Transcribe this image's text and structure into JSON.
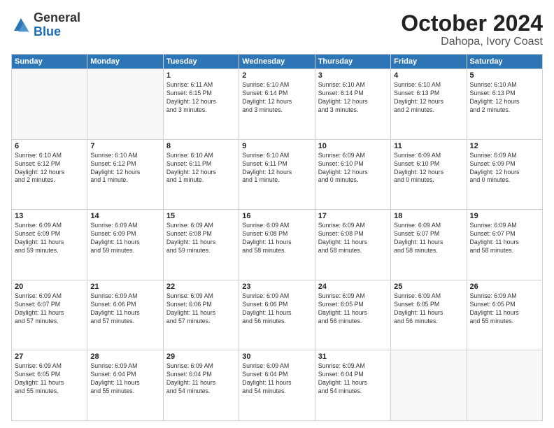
{
  "logo": {
    "line1": "General",
    "line2": "Blue"
  },
  "title": "October 2024",
  "subtitle": "Dahopa, Ivory Coast",
  "weekdays": [
    "Sunday",
    "Monday",
    "Tuesday",
    "Wednesday",
    "Thursday",
    "Friday",
    "Saturday"
  ],
  "weeks": [
    [
      {
        "day": "",
        "info": ""
      },
      {
        "day": "",
        "info": ""
      },
      {
        "day": "1",
        "info": "Sunrise: 6:11 AM\nSunset: 6:15 PM\nDaylight: 12 hours\nand 3 minutes."
      },
      {
        "day": "2",
        "info": "Sunrise: 6:10 AM\nSunset: 6:14 PM\nDaylight: 12 hours\nand 3 minutes."
      },
      {
        "day": "3",
        "info": "Sunrise: 6:10 AM\nSunset: 6:14 PM\nDaylight: 12 hours\nand 3 minutes."
      },
      {
        "day": "4",
        "info": "Sunrise: 6:10 AM\nSunset: 6:13 PM\nDaylight: 12 hours\nand 2 minutes."
      },
      {
        "day": "5",
        "info": "Sunrise: 6:10 AM\nSunset: 6:13 PM\nDaylight: 12 hours\nand 2 minutes."
      }
    ],
    [
      {
        "day": "6",
        "info": "Sunrise: 6:10 AM\nSunset: 6:12 PM\nDaylight: 12 hours\nand 2 minutes."
      },
      {
        "day": "7",
        "info": "Sunrise: 6:10 AM\nSunset: 6:12 PM\nDaylight: 12 hours\nand 1 minute."
      },
      {
        "day": "8",
        "info": "Sunrise: 6:10 AM\nSunset: 6:11 PM\nDaylight: 12 hours\nand 1 minute."
      },
      {
        "day": "9",
        "info": "Sunrise: 6:10 AM\nSunset: 6:11 PM\nDaylight: 12 hours\nand 1 minute."
      },
      {
        "day": "10",
        "info": "Sunrise: 6:09 AM\nSunset: 6:10 PM\nDaylight: 12 hours\nand 0 minutes."
      },
      {
        "day": "11",
        "info": "Sunrise: 6:09 AM\nSunset: 6:10 PM\nDaylight: 12 hours\nand 0 minutes."
      },
      {
        "day": "12",
        "info": "Sunrise: 6:09 AM\nSunset: 6:09 PM\nDaylight: 12 hours\nand 0 minutes."
      }
    ],
    [
      {
        "day": "13",
        "info": "Sunrise: 6:09 AM\nSunset: 6:09 PM\nDaylight: 11 hours\nand 59 minutes."
      },
      {
        "day": "14",
        "info": "Sunrise: 6:09 AM\nSunset: 6:09 PM\nDaylight: 11 hours\nand 59 minutes."
      },
      {
        "day": "15",
        "info": "Sunrise: 6:09 AM\nSunset: 6:08 PM\nDaylight: 11 hours\nand 59 minutes."
      },
      {
        "day": "16",
        "info": "Sunrise: 6:09 AM\nSunset: 6:08 PM\nDaylight: 11 hours\nand 58 minutes."
      },
      {
        "day": "17",
        "info": "Sunrise: 6:09 AM\nSunset: 6:08 PM\nDaylight: 11 hours\nand 58 minutes."
      },
      {
        "day": "18",
        "info": "Sunrise: 6:09 AM\nSunset: 6:07 PM\nDaylight: 11 hours\nand 58 minutes."
      },
      {
        "day": "19",
        "info": "Sunrise: 6:09 AM\nSunset: 6:07 PM\nDaylight: 11 hours\nand 58 minutes."
      }
    ],
    [
      {
        "day": "20",
        "info": "Sunrise: 6:09 AM\nSunset: 6:07 PM\nDaylight: 11 hours\nand 57 minutes."
      },
      {
        "day": "21",
        "info": "Sunrise: 6:09 AM\nSunset: 6:06 PM\nDaylight: 11 hours\nand 57 minutes."
      },
      {
        "day": "22",
        "info": "Sunrise: 6:09 AM\nSunset: 6:06 PM\nDaylight: 11 hours\nand 57 minutes."
      },
      {
        "day": "23",
        "info": "Sunrise: 6:09 AM\nSunset: 6:06 PM\nDaylight: 11 hours\nand 56 minutes."
      },
      {
        "day": "24",
        "info": "Sunrise: 6:09 AM\nSunset: 6:05 PM\nDaylight: 11 hours\nand 56 minutes."
      },
      {
        "day": "25",
        "info": "Sunrise: 6:09 AM\nSunset: 6:05 PM\nDaylight: 11 hours\nand 56 minutes."
      },
      {
        "day": "26",
        "info": "Sunrise: 6:09 AM\nSunset: 6:05 PM\nDaylight: 11 hours\nand 55 minutes."
      }
    ],
    [
      {
        "day": "27",
        "info": "Sunrise: 6:09 AM\nSunset: 6:05 PM\nDaylight: 11 hours\nand 55 minutes."
      },
      {
        "day": "28",
        "info": "Sunrise: 6:09 AM\nSunset: 6:04 PM\nDaylight: 11 hours\nand 55 minutes."
      },
      {
        "day": "29",
        "info": "Sunrise: 6:09 AM\nSunset: 6:04 PM\nDaylight: 11 hours\nand 54 minutes."
      },
      {
        "day": "30",
        "info": "Sunrise: 6:09 AM\nSunset: 6:04 PM\nDaylight: 11 hours\nand 54 minutes."
      },
      {
        "day": "31",
        "info": "Sunrise: 6:09 AM\nSunset: 6:04 PM\nDaylight: 11 hours\nand 54 minutes."
      },
      {
        "day": "",
        "info": ""
      },
      {
        "day": "",
        "info": ""
      }
    ]
  ]
}
